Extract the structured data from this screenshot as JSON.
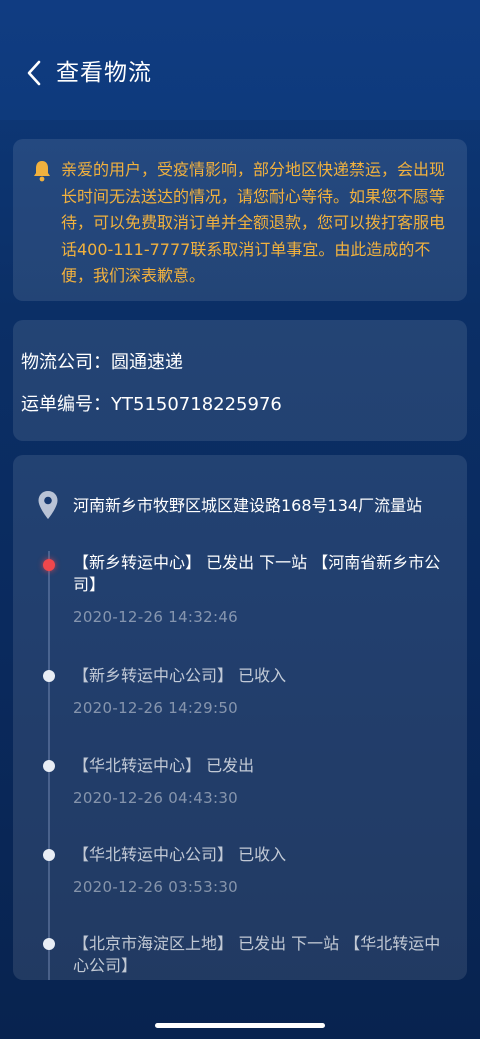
{
  "header": {
    "title": "查看物流"
  },
  "notice": {
    "text": "亲爱的用户，受疫情影响，部分地区快递禁运，会出现长时间无法送达的情况，请您耐心等待。如果您不愿等待，可以免费取消订单并全额退款，您可以拨打客服电话400-111-7777联系取消订单事宜。由此造成的不便，我们深表歉意。",
    "color": "#f1b13e"
  },
  "shipment": {
    "company": "物流公司：圆通速递",
    "tracking_no": "运单编号：YT5150718225976"
  },
  "tracking": {
    "address": "河南新乡市牧野区城区建设路168号134厂流量站",
    "events": [
      {
        "text": "【新乡转运中心】 已发出 下一站 【河南省新乡市公司】",
        "time": "2020-12-26 14:32:46",
        "active": true
      },
      {
        "text": "【新乡转运中心公司】 已收入",
        "time": "2020-12-26 14:29:50",
        "active": false
      },
      {
        "text": "【华北转运中心】 已发出",
        "time": "2020-12-26 04:43:30",
        "active": false
      },
      {
        "text": "【华北转运中心公司】 已收入",
        "time": "2020-12-26 03:53:30",
        "active": false
      },
      {
        "text": "【北京市海淀区上地】 已发出 下一站 【华北转运中心公司】",
        "time": "",
        "active": false
      }
    ]
  },
  "icons": {
    "back": "chevron-left-icon",
    "notice": "bell-icon",
    "location": "map-pin-icon"
  },
  "colors": {
    "background": "#0b2f66",
    "active_dot": "#f0474c"
  }
}
